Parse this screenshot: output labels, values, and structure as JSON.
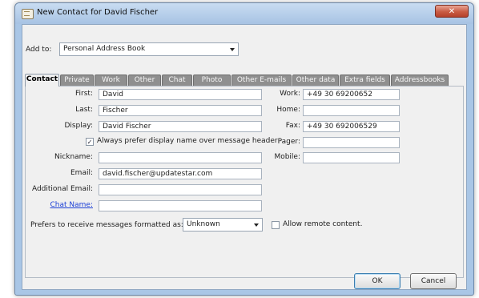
{
  "window": {
    "title": "New Contact for David Fischer",
    "close_glyph": "✕"
  },
  "add_to": {
    "label": "Add to:",
    "value": "Personal Address Book"
  },
  "tabs": [
    "Contact",
    "Private",
    "Work",
    "Other",
    "Chat",
    "Photo",
    "Other E-mails",
    "Other data",
    "Extra fields",
    "Addressbooks"
  ],
  "left_fields": {
    "first": {
      "label": "First:",
      "value": "David"
    },
    "last": {
      "label": "Last:",
      "value": "Fischer"
    },
    "display": {
      "label": "Display:",
      "value": "David Fischer"
    },
    "prefer_display": {
      "label": "Always prefer display name over message header",
      "checked": true
    },
    "nickname": {
      "label": "Nickname:",
      "value": ""
    },
    "email": {
      "label": "Email:",
      "value": "david.fischer@updatestar.com"
    },
    "additional_email": {
      "label": "Additional Email:",
      "value": ""
    },
    "chat_name": {
      "label": "Chat Name:",
      "value": ""
    }
  },
  "right_fields": {
    "work": {
      "label": "Work:",
      "value": "+49 30 69200652"
    },
    "home": {
      "label": "Home:",
      "value": ""
    },
    "fax": {
      "label": "Fax:",
      "value": "+49 30 692006529"
    },
    "pager": {
      "label": "Pager:",
      "value": ""
    },
    "mobile": {
      "label": "Mobile:",
      "value": ""
    }
  },
  "format": {
    "label": "Prefers to receive messages formatted as:",
    "value": "Unknown"
  },
  "remote_content": {
    "label": "Allow remote content.",
    "checked": false
  },
  "buttons": {
    "ok": "OK",
    "cancel": "Cancel"
  },
  "colors": {
    "frame": "#a9c6e6",
    "close": "#c85b43",
    "tab_inactive": "#8f8f8f",
    "link": "#1b3fd6"
  },
  "icons": {
    "app": "address-card-icon",
    "close": "close-icon",
    "dropdown": "chevron-down-icon",
    "check": "checkmark-icon"
  }
}
